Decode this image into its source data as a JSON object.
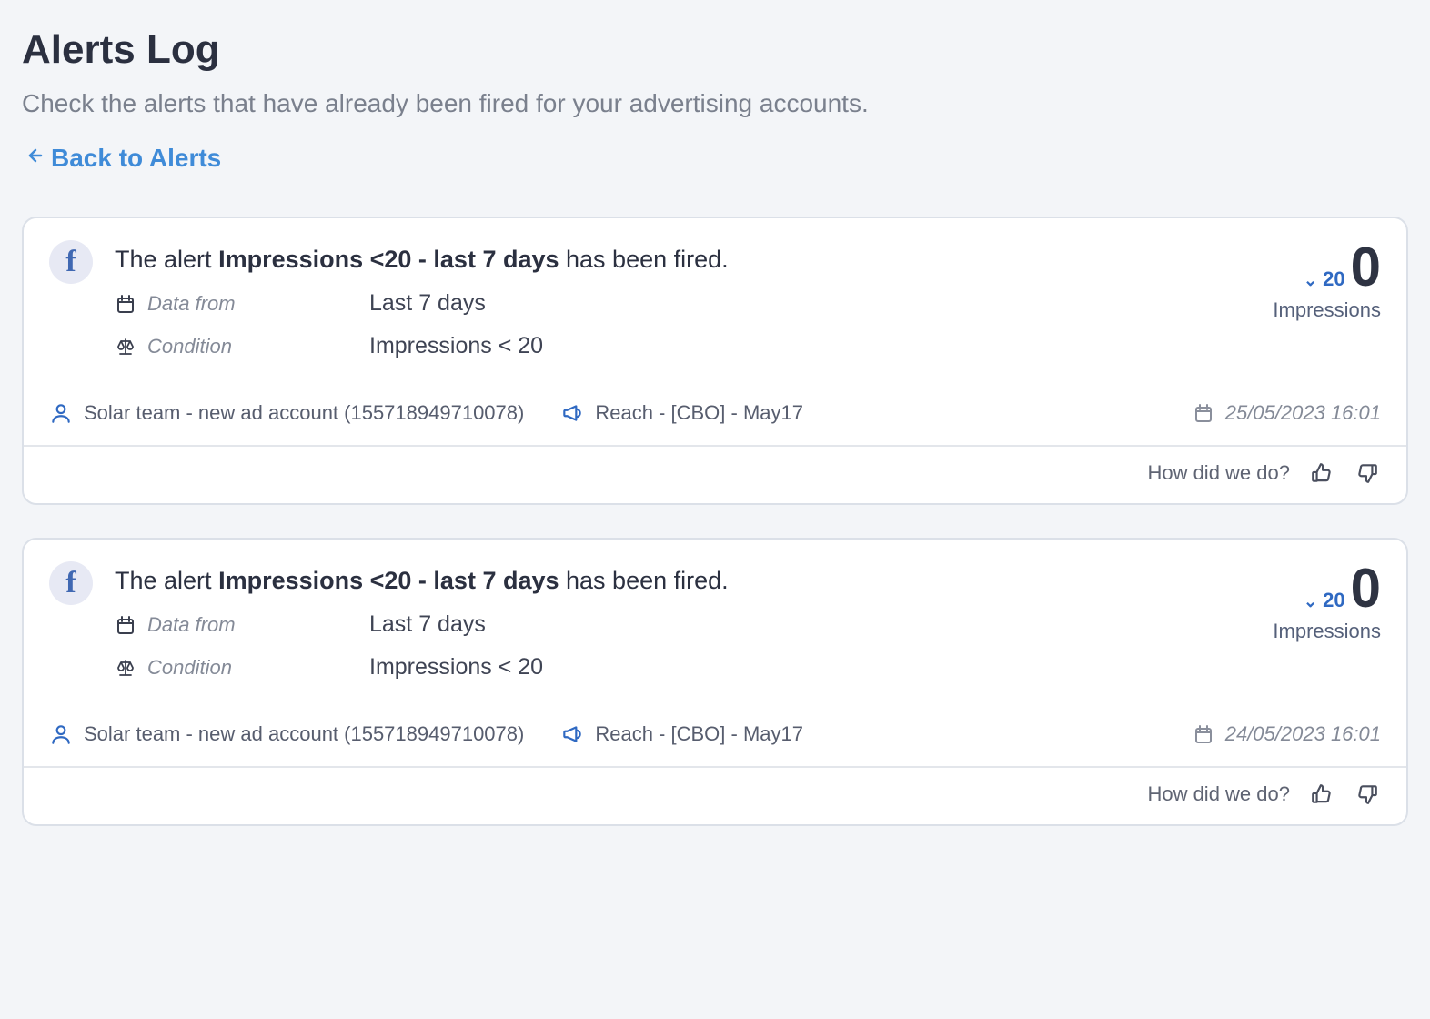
{
  "header": {
    "title": "Alerts Log",
    "subtitle": "Check the alerts that have already been fired for your advertising accounts.",
    "back_label": "Back to Alerts"
  },
  "labels": {
    "data_from": "Data from",
    "condition": "Condition",
    "feedback_prompt": "How did we do?"
  },
  "alerts": [
    {
      "platform": "facebook",
      "platform_glyph": "f",
      "title_prefix": "The alert ",
      "title_bold": "Impressions <20 - last 7 days",
      "title_suffix": " has been fired.",
      "data_from": "Last 7 days",
      "condition": "Impressions < 20",
      "metric_threshold": "20",
      "metric_value": "0",
      "metric_name": "Impressions",
      "account": "Solar team - new ad account (155718949710078)",
      "campaign": "Reach - [CBO] - May17",
      "timestamp": "25/05/2023 16:01"
    },
    {
      "platform": "facebook",
      "platform_glyph": "f",
      "title_prefix": "The alert ",
      "title_bold": "Impressions <20 - last 7 days",
      "title_suffix": " has been fired.",
      "data_from": "Last 7 days",
      "condition": "Impressions < 20",
      "metric_threshold": "20",
      "metric_value": "0",
      "metric_name": "Impressions",
      "account": "Solar team - new ad account (155718949710078)",
      "campaign": "Reach - [CBO] - May17",
      "timestamp": "24/05/2023 16:01"
    }
  ]
}
